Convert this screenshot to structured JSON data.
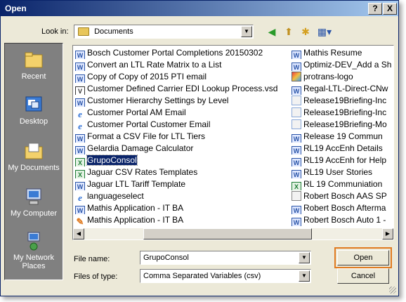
{
  "window": {
    "title": "Open"
  },
  "titlebar": {
    "help": "?",
    "close": "X"
  },
  "look_in": {
    "label": "Look in:",
    "value": "Documents"
  },
  "places": [
    {
      "label": "Recent"
    },
    {
      "label": "Desktop"
    },
    {
      "label": "My Documents"
    },
    {
      "label": "My Computer"
    },
    {
      "label": "My Network Places"
    }
  ],
  "files_col1": [
    {
      "icon": "word",
      "name": "Bosch Customer Portal Completions 20150302"
    },
    {
      "icon": "word",
      "name": "Convert an LTL Rate Matrix to a List"
    },
    {
      "icon": "word",
      "name": "Copy of Copy of 2015 PTI email"
    },
    {
      "icon": "visio",
      "name": "Customer Defined Carrier EDI Lookup Process.vsd"
    },
    {
      "icon": "word",
      "name": "Customer Hierarchy Settings by Level"
    },
    {
      "icon": "ie",
      "name": "Customer Portal AM Email"
    },
    {
      "icon": "ie",
      "name": "Customer Portal Customer Email"
    },
    {
      "icon": "word",
      "name": "Format a CSV File for LTL Tiers"
    },
    {
      "icon": "word",
      "name": "Gelardia Damage Calculator"
    },
    {
      "icon": "excel",
      "name": "GrupoConsol",
      "selected": true
    },
    {
      "icon": "excel",
      "name": "Jaguar CSV Rates Templates"
    },
    {
      "icon": "word",
      "name": "Jaguar LTL Tariff Template"
    },
    {
      "icon": "ie",
      "name": "languageselect"
    },
    {
      "icon": "word",
      "name": "Mathis Application - IT BA"
    },
    {
      "icon": "edit",
      "name": "Mathis Application - IT BA"
    }
  ],
  "files_col2": [
    {
      "icon": "word",
      "name": "Mathis Resume"
    },
    {
      "icon": "word",
      "name": "Optimiz-DEV_Add a Sh"
    },
    {
      "icon": "img",
      "name": "protrans-logo"
    },
    {
      "icon": "word",
      "name": "Regal-LTL-Direct-CNw"
    },
    {
      "icon": "web",
      "name": "Release19Briefing-Inc"
    },
    {
      "icon": "web",
      "name": "Release19Briefing-Inc"
    },
    {
      "icon": "web",
      "name": "Release19Briefing-Mo"
    },
    {
      "icon": "word",
      "name": "Release 19 Commun"
    },
    {
      "icon": "word",
      "name": "RL19 AccEnh Details"
    },
    {
      "icon": "word",
      "name": "RL19 AccEnh for Help"
    },
    {
      "icon": "word",
      "name": "RL19 User Stories"
    },
    {
      "icon": "excel",
      "name": "RL 19 Communiation"
    },
    {
      "icon": "pdf",
      "name": "Robert Bosch AAS SP"
    },
    {
      "icon": "word",
      "name": "Robert Bosch Afterma"
    },
    {
      "icon": "word",
      "name": "Robert Bosch Auto 1 -"
    }
  ],
  "file_name": {
    "label": "File name:",
    "value": "GrupoConsol"
  },
  "file_type": {
    "label": "Files of type:",
    "value": "Comma Separated Variables (csv)"
  },
  "buttons": {
    "open": "Open",
    "cancel": "Cancel"
  },
  "colors": {
    "title_start": "#0a246a",
    "title_end": "#a6caf0",
    "highlight": "#e07a1f",
    "selection": "#0a246a"
  }
}
